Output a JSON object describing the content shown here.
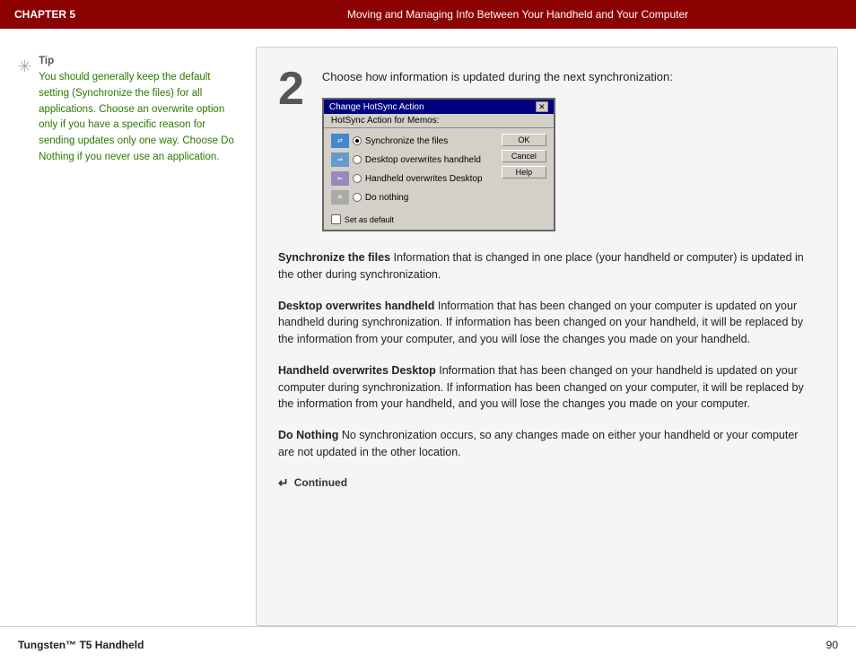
{
  "header": {
    "chapter": "CHAPTER 5",
    "title": "Moving and Managing Info Between Your Handheld and Your Computer"
  },
  "sidebar": {
    "tip_label": "Tip",
    "tip_text": "You should generally keep the default setting (Synchronize the files) for all applications. Choose an overwrite option only if you have a specific reason for sending updates only one way. Choose Do Nothing if you never use an application."
  },
  "content": {
    "step_number": "2",
    "step_instruction": "Choose how information is updated during the next synchronization:",
    "dialog": {
      "title": "Change HotSync Action",
      "app_label": "HotSync Action for Memos:",
      "options": [
        {
          "label": "Synchronize the files",
          "selected": true
        },
        {
          "label": "Desktop overwrites handheld",
          "selected": false
        },
        {
          "label": "Handheld overwrites Desktop",
          "selected": false
        },
        {
          "label": "Do nothing",
          "selected": false
        }
      ],
      "buttons": [
        "OK",
        "Cancel",
        "Help"
      ],
      "set_as_default_label": "Set as default"
    },
    "sections": [
      {
        "term": "Synchronize the files",
        "definition": "   Information that is changed in one place (your handheld or computer) is updated in the other during synchronization."
      },
      {
        "term": "Desktop overwrites handheld",
        "definition": "   Information that has been changed on your computer is updated on your handheld during synchronization. If information has been changed on your handheld, it will be replaced by the information from your computer, and you will lose the changes you made on your handheld."
      },
      {
        "term": "Handheld overwrites Desktop",
        "definition": "   Information that has been changed on your handheld is updated on your computer during synchronization. If information has been changed on your computer, it will be replaced by the information from your handheld, and you will lose the changes you made on your computer."
      },
      {
        "term": "Do Nothing",
        "definition": "   No synchronization occurs, so any changes made on either your handheld or your computer are not updated in the other location."
      }
    ],
    "continued_label": "Continued"
  },
  "footer": {
    "brand": "Tungsten™ T5 Handheld",
    "page": "90"
  }
}
